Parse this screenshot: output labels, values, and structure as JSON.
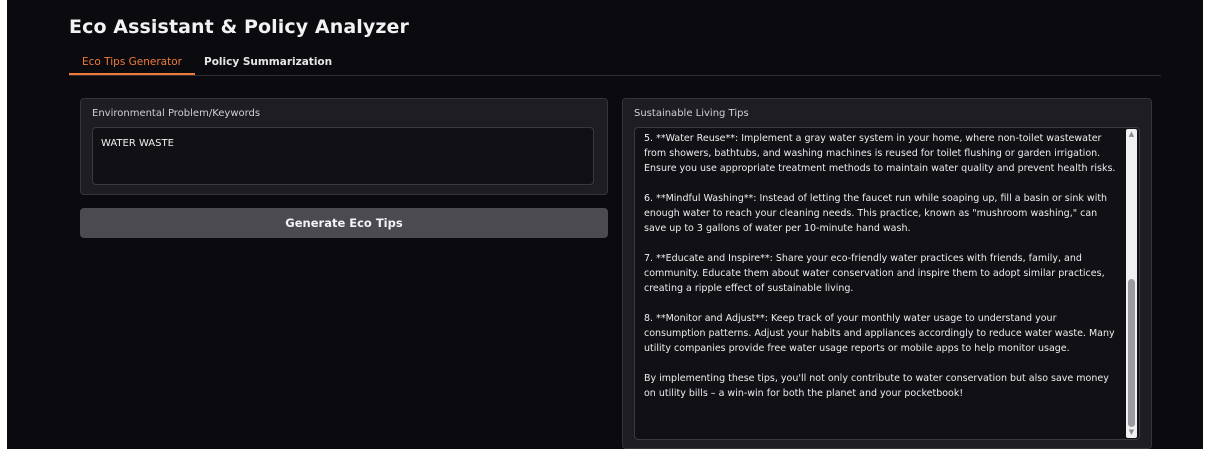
{
  "app": {
    "title": "Eco Assistant & Policy Analyzer"
  },
  "tabs": [
    {
      "label": "Eco Tips Generator",
      "active": true
    },
    {
      "label": "Policy Summarization",
      "active": false
    }
  ],
  "input_panel": {
    "label": "Environmental Problem/Keywords",
    "value": "WATER WASTE"
  },
  "generate_button": {
    "label": "Generate Eco Tips"
  },
  "output_panel": {
    "label": "Sustainable Living Tips",
    "paragraphs": [
      "5. **Water Reuse**: Implement a gray water system in your home, where non-toilet wastewater from showers, bathtubs, and washing machines is reused for toilet flushing or garden irrigation. Ensure you use appropriate treatment methods to maintain water quality and prevent health risks.",
      "6. **Mindful Washing**: Instead of letting the faucet run while soaping up, fill a basin or sink with enough water to reach your cleaning needs. This practice, known as \"mushroom washing,\" can save up to 3 gallons of water per 10-minute hand wash.",
      "7. **Educate and Inspire**: Share your eco-friendly water practices with friends, family, and community. Educate them about water conservation and inspire them to adopt similar practices, creating a ripple effect of sustainable living.",
      "8. **Monitor and Adjust**: Keep track of your monthly water usage to understand your consumption patterns. Adjust your habits and appliances accordingly to reduce water waste. Many utility companies provide free water usage reports or mobile apps to help monitor usage.",
      "By implementing these tips, you'll not only contribute to water conservation but also save money on utility bills – a win-win for both the planet and your pocketbook!"
    ],
    "scroll_position": 0.5
  },
  "icons": {
    "scroll_up": "triangle-up-icon",
    "scroll_down": "triangle-down-icon"
  },
  "colors": {
    "accent": "#f07a3a",
    "background": "#0b0b0f",
    "panel": "#1d1d22",
    "button": "#4a4a50"
  }
}
